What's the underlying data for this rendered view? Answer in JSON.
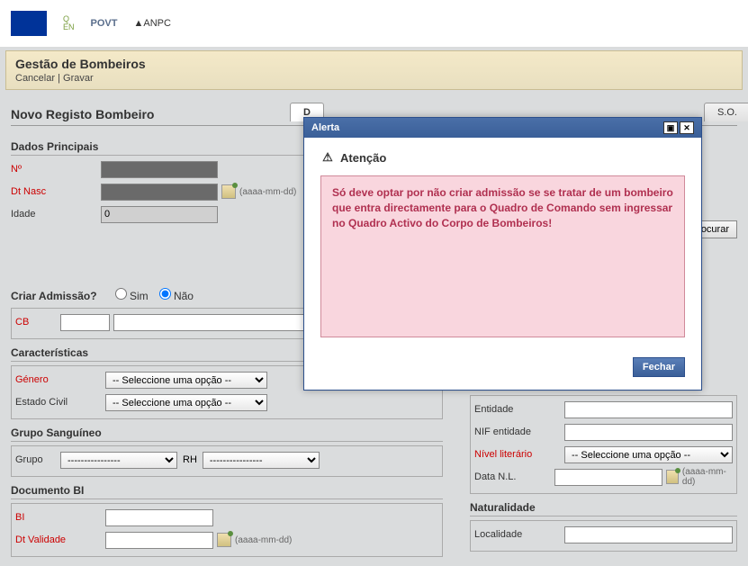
{
  "header": {
    "logos": {
      "qren": "QREN",
      "povt": "POVT",
      "anpc": "ANPC"
    }
  },
  "titlebar": {
    "title": "Gestão de Bombeiros",
    "cancel": "Cancelar",
    "sep": " | ",
    "save": "Gravar"
  },
  "page_title": "Novo Registo Bombeiro",
  "tabs": {
    "dados": "D",
    "so": "S.O."
  },
  "sections": {
    "dados_principais": "Dados Principais",
    "criar_admissao": "Criar Admissão?",
    "caracteristicas": "Características",
    "grupo_sanguineo": "Grupo Sanguíneo",
    "documento_bi": "Documento BI",
    "naturalidade": "Naturalidade"
  },
  "fields": {
    "no": "Nº",
    "dt_nasc": "Dt Nasc",
    "idade": "Idade",
    "idade_value": "0",
    "date_hint": "(aaaa-mm-dd)",
    "sim": "Sim",
    "nao": "Não",
    "cb": "CB",
    "genero": "Género",
    "estado_civil": "Estado Civil",
    "grupo": "Grupo",
    "rh": "RH",
    "bi": "BI",
    "dt_validade": "Dt Validade",
    "entidade": "Entidade",
    "nif_entidade": "NIF entidade",
    "nivel_literario": "Nível literário",
    "data_nl": "Data N.L.",
    "localidade": "Localidade",
    "select_placeholder": "-- Seleccione uma opção --",
    "dashes": "----------------",
    "procurar": "Procurar"
  },
  "modal": {
    "title": "Alerta",
    "heading": "Atenção",
    "message": "Só deve optar por não criar admissão se se tratar de um bombeiro que entra directamente para o Quadro de Comando sem ingressar no Quadro Activo do Corpo de Bombeiros!",
    "close": "Fechar"
  }
}
